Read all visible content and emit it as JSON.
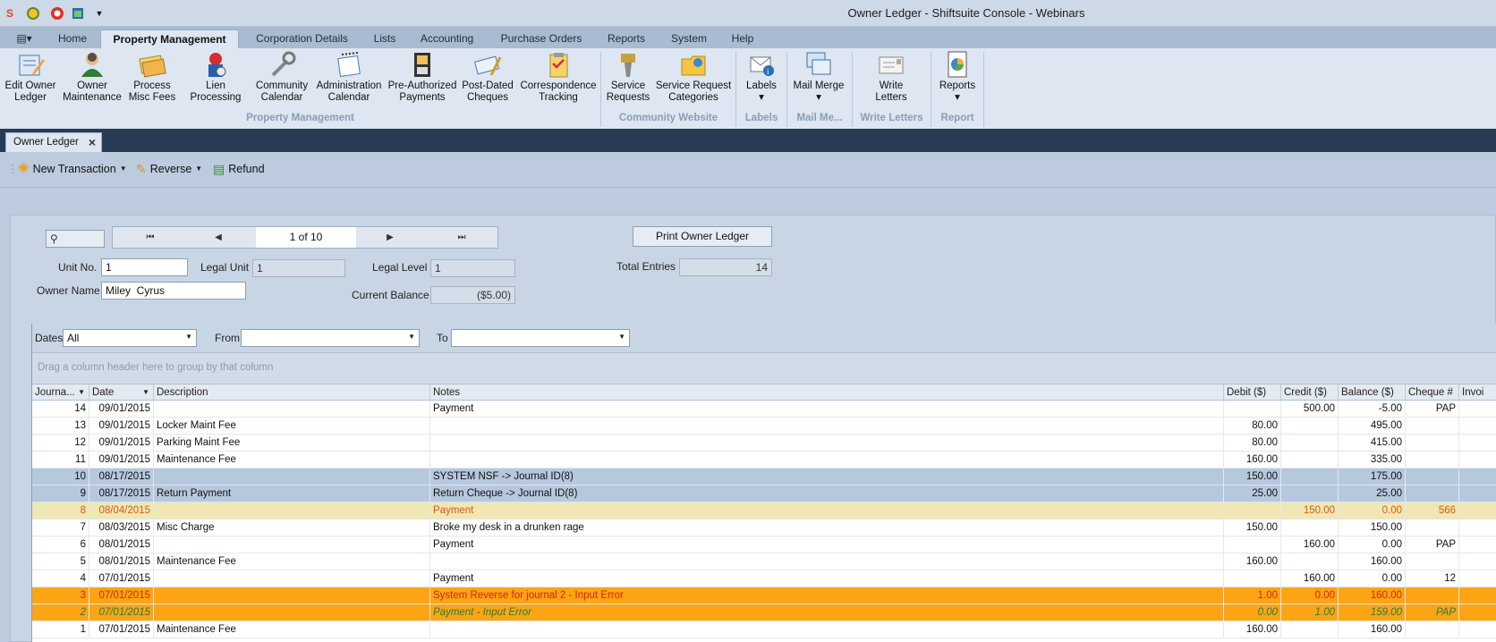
{
  "window": {
    "title": "Owner Ledger - Shiftsuite Console - Webinars"
  },
  "ribbon_tabs": [
    "Home",
    "Property Management",
    "Corporation Details",
    "Lists",
    "Accounting",
    "Purchase Orders",
    "Reports",
    "System",
    "Help"
  ],
  "ribbon_buttons": [
    {
      "l1": "Edit Owner",
      "l2": "Ledger"
    },
    {
      "l1": "Owner",
      "l2": "Maintenance"
    },
    {
      "l1": "Process",
      "l2": "Misc Fees"
    },
    {
      "l1": "Lien Processing",
      "l2": ""
    },
    {
      "l1": "Community",
      "l2": "Calendar"
    },
    {
      "l1": "Administration",
      "l2": "Calendar"
    },
    {
      "l1": "Pre-Authorized",
      "l2": "Payments"
    },
    {
      "l1": "Post-Dated",
      "l2": "Cheques"
    },
    {
      "l1": "Correspondence",
      "l2": "Tracking"
    },
    {
      "l1": "Service",
      "l2": "Requests"
    },
    {
      "l1": "Service Request",
      "l2": "Categories"
    },
    {
      "l1": "Labels",
      "l2": "▾"
    },
    {
      "l1": "Mail Merge",
      "l2": "▾"
    },
    {
      "l1": "Write",
      "l2": "Letters"
    },
    {
      "l1": "Reports",
      "l2": "▾"
    }
  ],
  "ribbon_groups": [
    "Property Management",
    "Community Website",
    "Labels",
    "Mail Me...",
    "Write Letters",
    "Report"
  ],
  "doc_tab": {
    "label": "Owner Ledger"
  },
  "toolbar": {
    "new_transaction": "New Transaction",
    "reverse": "Reverse",
    "refund": "Refund"
  },
  "form": {
    "page_indicator": "1 of 10",
    "print_button": "Print Owner Ledger",
    "unit_no_label": "Unit No.",
    "unit_no": "1",
    "legal_unit_label": "Legal Unit",
    "legal_unit": "1",
    "legal_level_label": "Legal Level",
    "legal_level": "1",
    "total_entries_label": "Total Entries",
    "total_entries": "14",
    "owner_name_label": "Owner Name",
    "owner_name": "Miley  Cyrus",
    "current_balance_label": "Current Balance",
    "current_balance": "($5.00)"
  },
  "filters": {
    "dates_label": "Dates",
    "dates_value": "All",
    "from_label": "From",
    "from_value": "",
    "to_label": "To",
    "to_value": ""
  },
  "group_hint": "Drag a column header here to group by that column",
  "columns": [
    "Journa...",
    "Date",
    "Description",
    "Notes",
    "Debit ($)",
    "Credit ($)",
    "Balance ($)",
    "Cheque #",
    "Invoi"
  ],
  "rows": [
    {
      "journal": "14",
      "date": "09/01/2015",
      "description": "",
      "notes": "Payment",
      "debit": "",
      "credit": "500.00",
      "balance": "-5.00",
      "cheque": "PAP",
      "style": ""
    },
    {
      "journal": "13",
      "date": "09/01/2015",
      "description": "Locker Maint Fee",
      "notes": "",
      "debit": "80.00",
      "credit": "",
      "balance": "495.00",
      "cheque": "",
      "style": ""
    },
    {
      "journal": "12",
      "date": "09/01/2015",
      "description": "Parking Maint Fee",
      "notes": "",
      "debit": "80.00",
      "credit": "",
      "balance": "415.00",
      "cheque": "",
      "style": ""
    },
    {
      "journal": "11",
      "date": "09/01/2015",
      "description": "Maintenance Fee",
      "notes": "",
      "debit": "160.00",
      "credit": "",
      "balance": "335.00",
      "cheque": "",
      "style": ""
    },
    {
      "journal": "10",
      "date": "08/17/2015",
      "description": "",
      "notes": "SYSTEM NSF -> Journal ID(8)",
      "debit": "150.00",
      "credit": "",
      "balance": "175.00",
      "cheque": "",
      "style": "sel"
    },
    {
      "journal": "9",
      "date": "08/17/2015",
      "description": "Return Payment",
      "notes": "Return Cheque -> Journal ID(8)",
      "debit": "25.00",
      "credit": "",
      "balance": "25.00",
      "cheque": "",
      "style": "sel"
    },
    {
      "journal": "8",
      "date": "08/04/2015",
      "description": "",
      "notes": "Payment",
      "debit": "",
      "credit": "150.00",
      "balance": "0.00",
      "cheque": "566",
      "style": "yel"
    },
    {
      "journal": "7",
      "date": "08/03/2015",
      "description": "Misc Charge",
      "notes": "Broke my desk in a drunken rage",
      "debit": "150.00",
      "credit": "",
      "balance": "150.00",
      "cheque": "",
      "style": ""
    },
    {
      "journal": "6",
      "date": "08/01/2015",
      "description": "",
      "notes": "Payment",
      "debit": "",
      "credit": "160.00",
      "balance": "0.00",
      "cheque": "PAP",
      "style": ""
    },
    {
      "journal": "5",
      "date": "08/01/2015",
      "description": "Maintenance Fee",
      "notes": "",
      "debit": "160.00",
      "credit": "",
      "balance": "160.00",
      "cheque": "",
      "style": ""
    },
    {
      "journal": "4",
      "date": "07/01/2015",
      "description": "",
      "notes": "Payment",
      "debit": "",
      "credit": "160.00",
      "balance": "0.00",
      "cheque": "12",
      "style": ""
    },
    {
      "journal": "3",
      "date": "07/01/2015",
      "description": "",
      "notes": "System Reverse for journal 2 - Input Error",
      "debit": "1.00",
      "credit": "0.00",
      "balance": "160.00",
      "cheque": "",
      "style": "org"
    },
    {
      "journal": "2",
      "date": "07/01/2015",
      "description": "",
      "notes": "Payment - Input Error",
      "debit": "0.00",
      "credit": "1.00",
      "balance": "159.00",
      "cheque": "PAP",
      "style": "org2"
    },
    {
      "journal": "1",
      "date": "07/01/2015",
      "description": "Maintenance Fee",
      "notes": "",
      "debit": "160.00",
      "credit": "",
      "balance": "160.00",
      "cheque": "",
      "style": ""
    }
  ]
}
